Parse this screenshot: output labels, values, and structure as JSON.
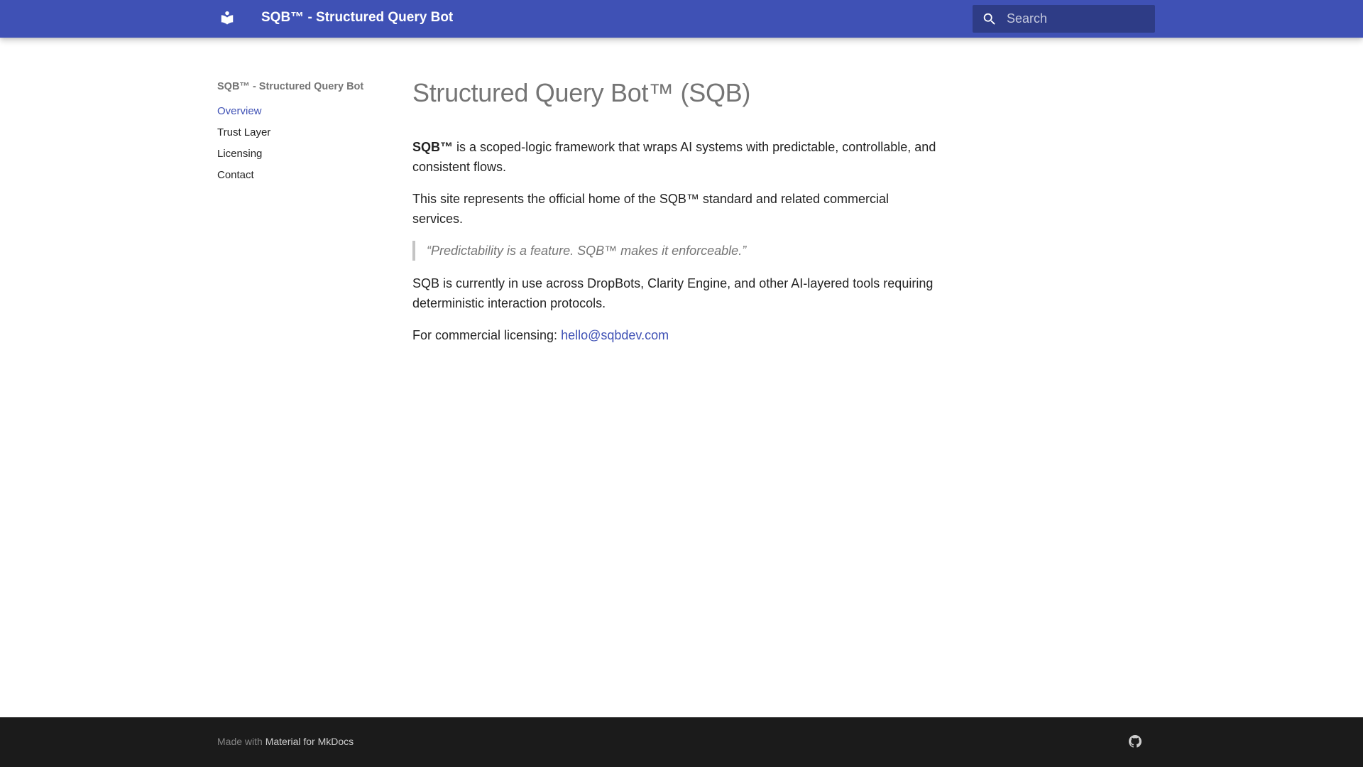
{
  "header": {
    "logo_icon": "book-reader-icon",
    "site_title": "SQB™ - Structured Query Bot",
    "search_icon": "search-icon",
    "search_placeholder": "Search",
    "search_value": "",
    "colors": {
      "primary": "#3f51b5"
    }
  },
  "nav": {
    "title": "SQB™ - Structured Query Bot",
    "items": [
      {
        "label": "Overview",
        "active": true
      },
      {
        "label": "Trust Layer",
        "active": false
      },
      {
        "label": "Licensing",
        "active": false
      },
      {
        "label": "Contact",
        "active": false
      }
    ]
  },
  "content": {
    "title": "Structured Query Bot™ (SQB)",
    "p1_bold": "SQB™",
    "p1_rest": " is a scoped-logic framework that wraps AI systems with predictable, controllable, and consistent flows.",
    "p2": "This site represents the official home of the SQB™ standard and related commercial services.",
    "quote": "“Predictability is a feature. SQB™ makes it enforceable.”",
    "p3": "SQB is currently in use across DropBots, Clarity Engine, and other AI-layered tools requiring deterministic interaction protocols.",
    "p4_prefix": "For commercial licensing: ",
    "p4_email": "hello@sqbdev.com"
  },
  "footer": {
    "made_with": "Made with ",
    "link_label": "Material for MkDocs",
    "github_icon": "github-icon",
    "background": "#1b1b1b"
  }
}
